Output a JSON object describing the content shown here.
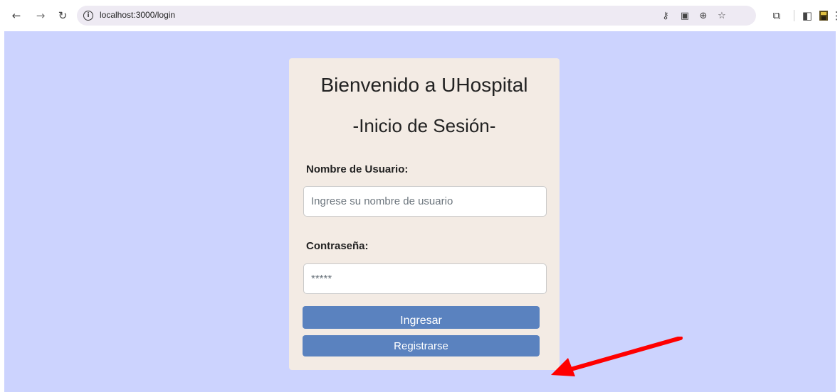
{
  "browser": {
    "url": "localhost:3000/login",
    "icons": [
      "back-arrow-icon",
      "forward-arrow-icon",
      "reload-icon",
      "info-icon",
      "key-icon",
      "translate-icon",
      "zoom-icon",
      "star-icon",
      "extensions-icon",
      "side-panel-icon",
      "profile-icon",
      "menu-icon"
    ]
  },
  "login": {
    "title": "Bienvenido a UHospital",
    "subtitle": "-Inicio de Sesión-",
    "username_label": "Nombre de Usuario:",
    "username_placeholder": "Ingrese su nombre de usuario",
    "password_label": "Contraseña:",
    "password_placeholder": "*****",
    "login_button": "Ingresar",
    "register_button": "Registrarse"
  },
  "colors": {
    "page_background": "#ccd3fe",
    "card_background": "#f3ebe4",
    "button": "#5a82bf",
    "annotation_arrow": "#ff0000"
  }
}
